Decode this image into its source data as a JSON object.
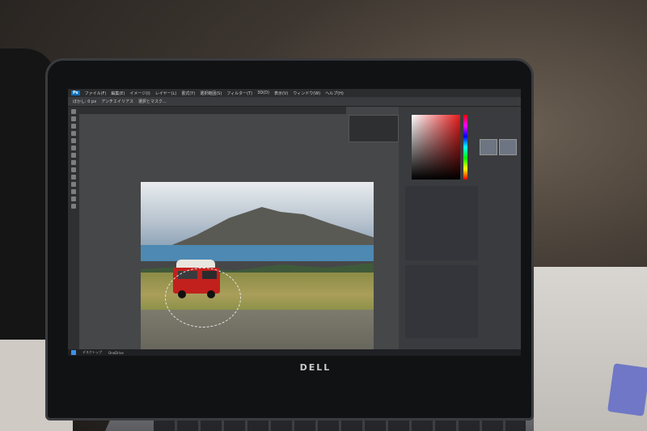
{
  "screen": {
    "app_title": "Ps",
    "menu_items": [
      "ファイル(F)",
      "編集(E)",
      "イメージ(I)",
      "レイヤー(L)",
      "書式(Y)",
      "選択範囲(S)",
      "フィルター(T)",
      "3D(D)",
      "表示(V)",
      "ウィンドウ(W)",
      "ヘルプ(H)"
    ],
    "options_items": [
      "ぼかし: 0 px",
      "アンチエイリアス",
      "選択とマスク..."
    ],
    "document_tab": "",
    "taskbar_items": [
      "デスクトップ",
      "OneDrive"
    ],
    "brand": "DELL",
    "accent_color": "#0b74c4",
    "van_color": "#c2201d"
  }
}
